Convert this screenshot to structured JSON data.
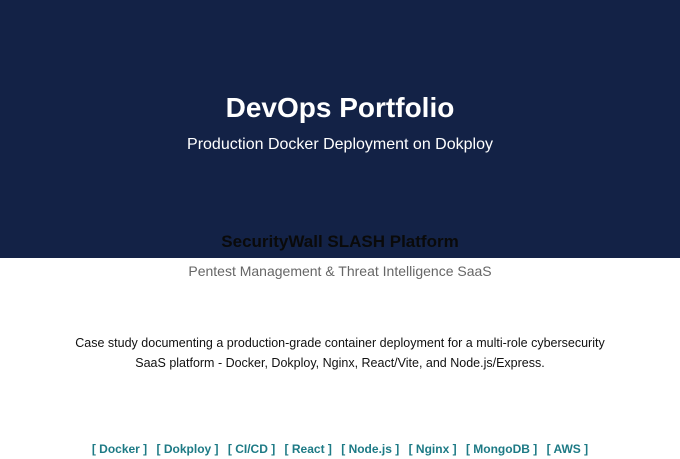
{
  "hero": {
    "title": "DevOps Portfolio",
    "subtitle": "Production Docker Deployment on Dokploy",
    "background_color": "#132246"
  },
  "project": {
    "title": "SecurityWall SLASH Platform",
    "tagline": "Pentest Management & Threat Intelligence SaaS"
  },
  "description": {
    "line1": "Case study documenting a production-grade container deployment for a multi-role cybersecurity",
    "line2": "SaaS platform  -  Docker, Dokploy, Nginx, React/Vite, and Node.js/Express."
  },
  "tags": [
    "[ Docker ]",
    "[ Dokploy ]",
    "[ CI/CD ]",
    "[ React ]",
    "[ Node.js ]",
    "[ Nginx ]",
    "[ MongoDB ]",
    "[ AWS ]"
  ],
  "tag_color": "#1d7a85"
}
